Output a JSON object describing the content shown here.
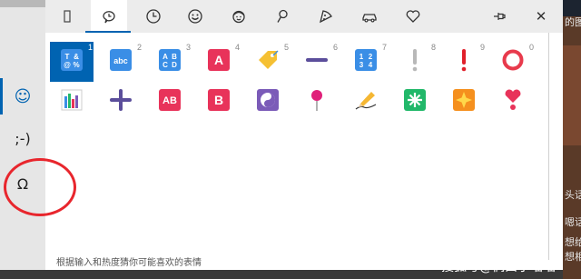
{
  "sidebar": {
    "items": [
      {
        "label": "☺",
        "name": "emoji"
      },
      {
        "label": ";-)",
        "name": "kaomoji"
      },
      {
        "label": "Ω",
        "name": "symbols"
      }
    ]
  },
  "tabs": [
    {
      "name": "keyboard-icon"
    },
    {
      "name": "recent-icon"
    },
    {
      "name": "history-icon"
    },
    {
      "name": "smiley-icon"
    },
    {
      "name": "person-icon"
    },
    {
      "name": "location-pin-icon"
    },
    {
      "name": "pizza-icon"
    },
    {
      "name": "car-icon"
    },
    {
      "name": "heart-icon"
    }
  ],
  "window": {
    "pin": "pin-icon",
    "close_label": "✕"
  },
  "emoji_rows": [
    [
      {
        "name": "input-symbols-emoji",
        "num": "1",
        "txt": "T&@%",
        "color": "#3a8ee6",
        "kind": "box"
      },
      {
        "name": "abc-emoji",
        "num": "2",
        "txt": "abc",
        "color": "#3a8ee6",
        "kind": "box"
      },
      {
        "name": "abcd-emoji",
        "num": "3",
        "txt": "ABCD",
        "color": "#3a8ee6",
        "kind": "box"
      },
      {
        "name": "a-button-emoji",
        "num": "4",
        "txt": "A",
        "color": "#e8335a",
        "kind": "box"
      },
      {
        "name": "label-tag-emoji",
        "num": "5",
        "txt": "",
        "color": "#f5c033",
        "kind": "tag"
      },
      {
        "name": "minus-emoji",
        "num": "6",
        "txt": "",
        "color": "#5b4e9b",
        "kind": "minus"
      },
      {
        "name": "1234-emoji",
        "num": "7",
        "txt": "1234",
        "color": "#3a8ee6",
        "kind": "box"
      },
      {
        "name": "white-exclamation-emoji",
        "num": "8",
        "txt": "",
        "color": "#b8b8b8",
        "kind": "exclaim"
      },
      {
        "name": "red-exclamation-emoji",
        "num": "9",
        "txt": "",
        "color": "#e0202a",
        "kind": "exclaim"
      },
      {
        "name": "red-circle-emoji",
        "num": "0",
        "txt": "",
        "color": "#e83a4c",
        "kind": "ring"
      }
    ],
    [
      {
        "name": "chart-emoji",
        "num": "",
        "txt": "",
        "color": "#3a8ee6",
        "kind": "bars"
      },
      {
        "name": "plus-emoji",
        "num": "",
        "txt": "",
        "color": "#5b4e9b",
        "kind": "plus"
      },
      {
        "name": "ab-button-emoji",
        "num": "",
        "txt": "AB",
        "color": "#e8335a",
        "kind": "box"
      },
      {
        "name": "b-button-emoji",
        "num": "",
        "txt": "B",
        "color": "#e8335a",
        "kind": "box"
      },
      {
        "name": "yin-yang-emoji",
        "num": "",
        "txt": "",
        "color": "#7b5bb8",
        "kind": "yinyang"
      },
      {
        "name": "round-pushpin-emoji",
        "num": "",
        "txt": "",
        "color": "#e0207a",
        "kind": "pin"
      },
      {
        "name": "pencil-writing-emoji",
        "num": "",
        "txt": "",
        "color": "#f5b733",
        "kind": "pencil"
      },
      {
        "name": "eight-spoked-asterisk-emoji",
        "num": "",
        "txt": "",
        "color": "#22b86a",
        "kind": "spark"
      },
      {
        "name": "eight-pointed-star-emoji",
        "num": "",
        "txt": "",
        "color": "#f5901e",
        "kind": "star"
      },
      {
        "name": "heart-exclamation-emoji",
        "num": "",
        "txt": "",
        "color": "#e8335a",
        "kind": "heartex"
      }
    ]
  ],
  "hint": "根据输入和热度猜你可能喜欢的表情",
  "watermark": "搜狐号@偶西小喵喵",
  "background_text": [
    "的图",
    "头话",
    "嗯话",
    "想给",
    "想相"
  ]
}
